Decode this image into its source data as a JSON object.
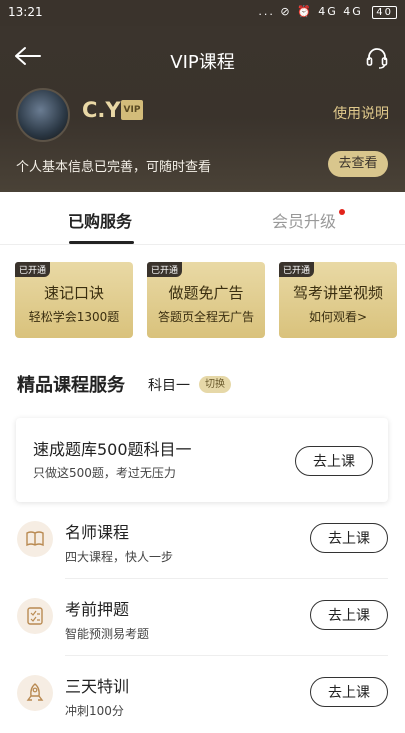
{
  "status": {
    "time": "13:21",
    "icons": "... ⊘ ⏰ 4G 4G",
    "battery": "40"
  },
  "header": {
    "title": "VIP课程",
    "username": "C.Y",
    "vip_badge": "VIP",
    "help": "使用说明",
    "info": "个人基本信息已完善，可随时查看",
    "view_button": "去查看"
  },
  "tabs": [
    {
      "label": "已购服务"
    },
    {
      "label": "会员升级"
    }
  ],
  "cards": [
    {
      "tag": "已开通",
      "title": "速记口诀",
      "subtitle": "轻松学会1300题"
    },
    {
      "tag": "已开通",
      "title": "做题免广告",
      "subtitle": "答题页全程无广告"
    },
    {
      "tag": "已开通",
      "title": "驾考讲堂视频",
      "subtitle": "如何观看>"
    }
  ],
  "section": {
    "title": "精品课程服务",
    "subject": "科目一",
    "switch": "切换"
  },
  "featured": {
    "title": "速成题库500题科目一",
    "subtitle": "只做这500题，考过无压力",
    "button": "去上课"
  },
  "courses": [
    {
      "icon": "book-icon",
      "title": "名师课程",
      "subtitle": "四大课程，快人一步",
      "button": "去上课"
    },
    {
      "icon": "checklist-icon",
      "title": "考前押题",
      "subtitle": "智能预测易考题",
      "button": "去上课"
    },
    {
      "icon": "rocket-icon",
      "title": "三天特训",
      "subtitle": "冲刺100分",
      "button": "去上课"
    }
  ],
  "colors": {
    "header_bg": "#3a332c",
    "gold": "#d9c68d",
    "accent_dot": "#e2231a"
  }
}
